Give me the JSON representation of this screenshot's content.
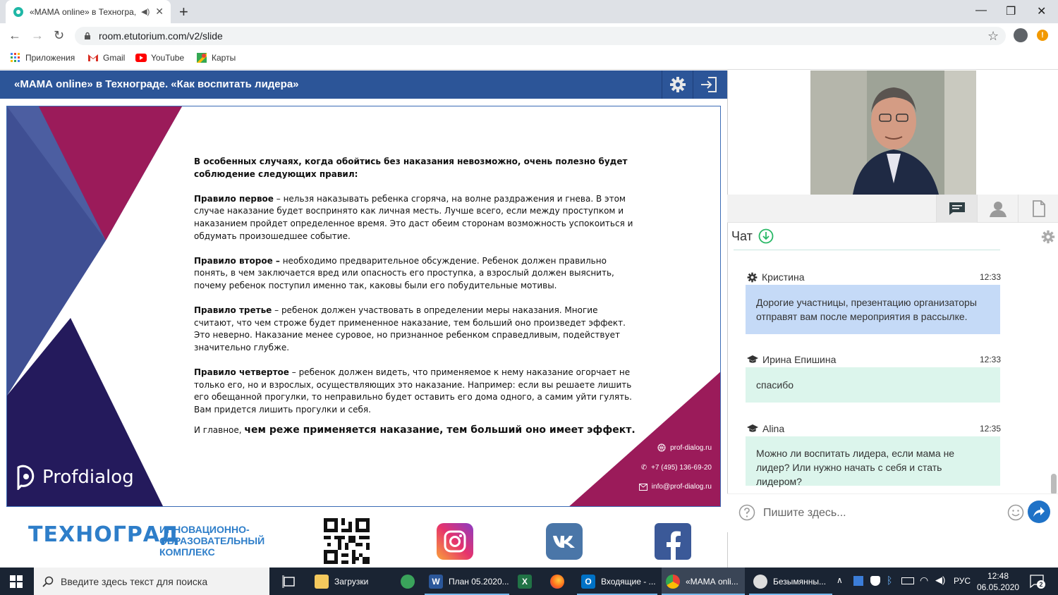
{
  "browser": {
    "tab_title": "«МАМА online» в Техногра,",
    "url": "room.etutorium.com/v2/slide",
    "bookmarks": [
      {
        "label": "Приложения"
      },
      {
        "label": "Gmail"
      },
      {
        "label": "YouTube"
      },
      {
        "label": "Карты"
      }
    ]
  },
  "webinar": {
    "title": "«МАМА online» в Технограде. «Как воспитать лидера»"
  },
  "slide": {
    "intro": "В особенных случаях, когда обойтись без наказания невозможно, очень полезно будет соблюдение следующих правил:",
    "rules": [
      {
        "head": "Правило первое",
        "text": " – нельзя наказывать ребенка сгоряча, на волне раздражения и гнева. В этом случае наказание будет воспринято как личная месть. Лучше всего, если между проступком и наказанием пройдет определенное время. Это даст обеим сторонам возможность успокоиться и обдумать произошедшее событие."
      },
      {
        "head": "Правило второе –",
        "text": " необходимо предварительное обсуждение. Ребенок должен правильно понять, в чем заключается вред или опасность его проступка, а взрослый должен выяснить, почему ребенок поступил именно так, каковы были его побудительные мотивы."
      },
      {
        "head": "Правило третье",
        "text": " – ребенок должен участвовать в определении меры наказания. Многие считают, что чем строже будет примененное наказание, тем больший оно произведет эффект. Это неверно. Наказание менее суровое, но признанное ребенком справедливым, подействует значительно глубже."
      },
      {
        "head": "Правило четвертое",
        "text": " – ребенок должен видеть, что применяемое к нему наказание огорчает не только его, но и взрослых, осуществляющих это наказание. Например: если вы решаете лишить его обещанной прогулки, то неправильно будет оставить его дома одного, а самим уйти гулять. Вам придется лишить прогулки и себя."
      }
    ],
    "final_prefix": "И главное, ",
    "final_bold": "чем реже применяется наказание, тем больший оно имеет эффект.",
    "brand": "Profdialog",
    "site": "prof-dialog.ru",
    "phone": "+7 (495) 136-69-20",
    "email": "info@prof-dialog.ru"
  },
  "footer": {
    "logo": "ТЕХНОГРАД",
    "caption_lines": [
      "ИННОВАЦИОННО-",
      "ОБРАЗОВАТЕЛЬНЫЙ",
      "КОМПЛЕКС"
    ]
  },
  "chat": {
    "title": "Чат",
    "placeholder": "Пишите здесь...",
    "messages": [
      {
        "author": "Кристина",
        "time": "12:33",
        "text": "Дорогие участницы, презентацию организаторы отправят вам после мероприятия в рассылке.",
        "style": "blue",
        "icon": "gear-icon"
      },
      {
        "author": "Ирина Епишина",
        "time": "12:33",
        "text": "спасибо",
        "style": "green",
        "icon": "graduation-cap-icon"
      },
      {
        "author": "Alina",
        "time": "12:35",
        "text": "Можно ли воспитать лидера, если мама не лидер? Или нужно начать с себя и стать лидером?",
        "style": "green",
        "icon": "graduation-cap-icon"
      }
    ]
  },
  "taskbar": {
    "search_placeholder": "Введите здесь текст для поиска",
    "items": [
      {
        "label": "Загрузки"
      },
      {
        "label": ""
      },
      {
        "label": "План 05.2020..."
      },
      {
        "label": ""
      },
      {
        "label": ""
      },
      {
        "label": "Входящие - ..."
      },
      {
        "label": "«МАМА onli..."
      },
      {
        "label": "Безымянны..."
      }
    ],
    "lang": "РУС",
    "time": "12:48",
    "date": "06.05.2020",
    "notif_count": "2"
  },
  "colors": {
    "header_blue": "#2c5598",
    "slide_crimson": "#9b1b5a",
    "slide_navy": "#241a5c",
    "slide_slate": "#4c5ea1",
    "bubble_blue": "#c5daf7",
    "bubble_green": "#dcf5ec"
  }
}
